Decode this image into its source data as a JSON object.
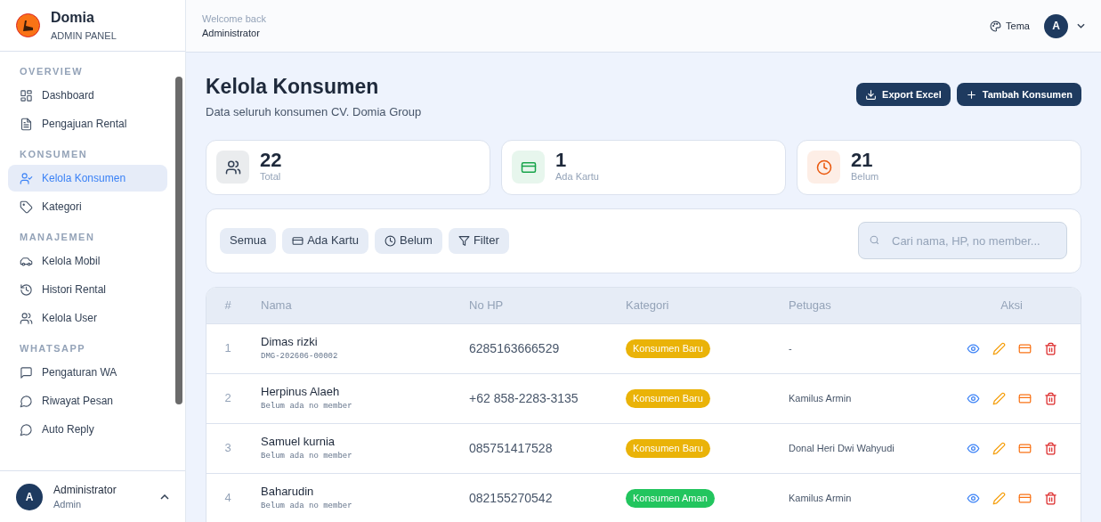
{
  "brand": {
    "name": "Domia",
    "subtitle": "ADMIN PANEL"
  },
  "sidebar": {
    "sections": [
      {
        "title": "OVERVIEW",
        "items": [
          {
            "label": "Dashboard",
            "selected": false
          },
          {
            "label": "Pengajuan Rental",
            "selected": false
          }
        ]
      },
      {
        "title": "KONSUMEN",
        "items": [
          {
            "label": "Kelola Konsumen",
            "selected": true
          },
          {
            "label": "Kategori",
            "selected": false
          }
        ]
      },
      {
        "title": "MANAJEMEN",
        "items": [
          {
            "label": "Kelola Mobil",
            "selected": false
          },
          {
            "label": "Histori Rental",
            "selected": false
          },
          {
            "label": "Kelola User",
            "selected": false
          }
        ]
      },
      {
        "title": "WHATSAPP",
        "items": [
          {
            "label": "Pengaturan WA",
            "selected": false
          },
          {
            "label": "Riwayat Pesan",
            "selected": false
          },
          {
            "label": "Auto Reply",
            "selected": false
          }
        ]
      }
    ],
    "user": {
      "initial": "A",
      "name": "Administrator",
      "role": "Admin"
    }
  },
  "header": {
    "greeting": "Welcome back",
    "user": "Administrator",
    "theme_label": "Tema",
    "avatar_initial": "A"
  },
  "page": {
    "title": "Kelola Konsumen",
    "subtitle": "Data seluruh konsumen CV. Domia Group",
    "buttons": [
      "Export Excel",
      "Tambah Konsumen"
    ]
  },
  "stats": [
    {
      "value": "22",
      "label": "Total",
      "color": "#334155"
    },
    {
      "value": "1",
      "label": "Ada Kartu",
      "color": "#16a34a"
    },
    {
      "value": "21",
      "label": "Belum",
      "color": "#ea580c"
    }
  ],
  "filters": [
    "Semua",
    "Ada Kartu",
    "Belum",
    "Filter"
  ],
  "search": {
    "placeholder": "Cari nama, HP, no member..."
  },
  "table": {
    "columns": [
      "#",
      "Nama",
      "No HP",
      "Kategori",
      "Petugas",
      "Aksi"
    ],
    "rows": [
      {
        "no": "1",
        "name": "Dimas rizki",
        "member": "DMG-202606-00002",
        "phone": "6285163666529",
        "category": "Konsumen Baru",
        "color": "#eab308",
        "officer": "-"
      },
      {
        "no": "2",
        "name": "Herpinus Alaeh",
        "member": "Belum ada no member",
        "phone": "+62 858-2283-3135",
        "category": "Konsumen Baru",
        "color": "#eab308",
        "officer": "Kamilus Armin"
      },
      {
        "no": "3",
        "name": "Samuel kurnia",
        "member": "Belum ada no member",
        "phone": "085751417528",
        "category": "Konsumen Baru",
        "color": "#eab308",
        "officer": "Donal Heri Dwi Wahyudi"
      },
      {
        "no": "4",
        "name": "Baharudin",
        "member": "Belum ada no member",
        "phone": "082155270542",
        "category": "Konsumen Aman",
        "color": "#22c55e",
        "officer": "Kamilus Armin"
      }
    ]
  }
}
